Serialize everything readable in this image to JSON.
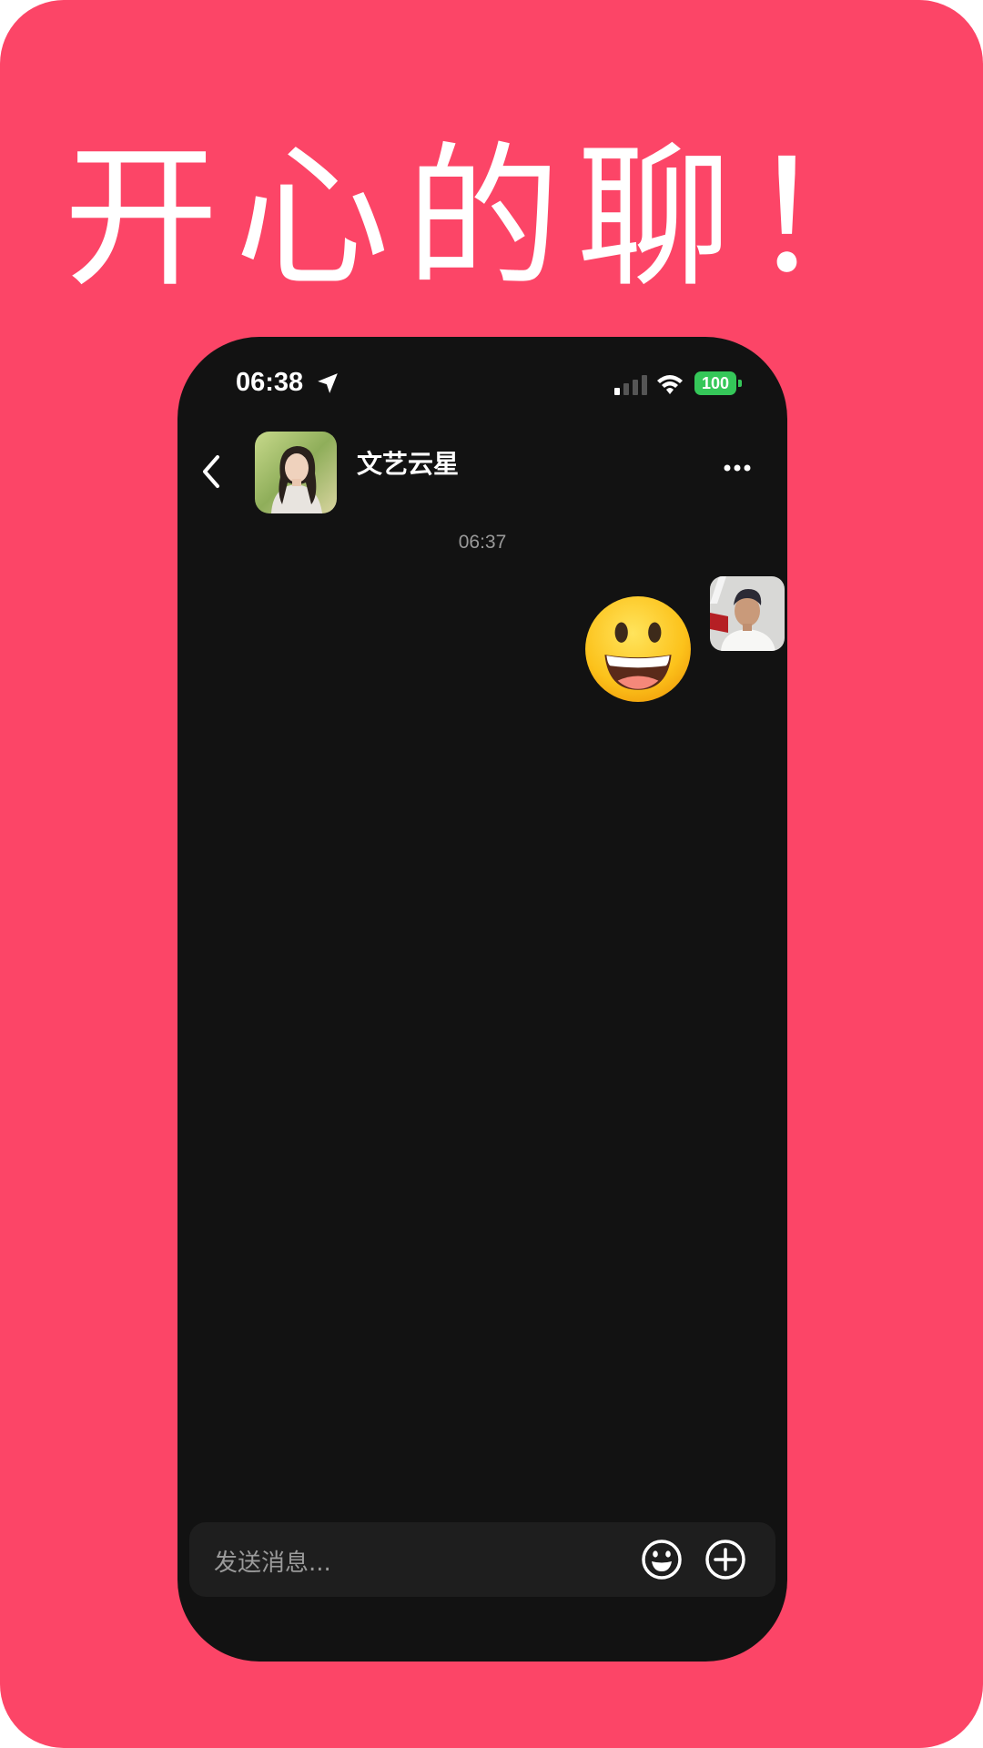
{
  "headline": "开心的聊！",
  "status_bar": {
    "time": "06:38",
    "battery": "100",
    "icons": [
      "location-arrow-icon",
      "cellular-signal-icon",
      "wifi-icon",
      "battery-icon"
    ]
  },
  "chat_header": {
    "contact_name": "文艺云星",
    "icons": [
      "back-arrow-icon",
      "more-dots-icon"
    ]
  },
  "messages": {
    "timestamp": "06:37",
    "items": [
      {
        "sender": "self",
        "type": "emoji",
        "icon": "grinning-face-emoji"
      }
    ]
  },
  "input_bar": {
    "placeholder": "发送消息...",
    "icons": [
      "emoji-smile-icon",
      "plus-circle-icon"
    ]
  },
  "colors": {
    "background": "#fc4567",
    "phone": "#121212",
    "input": "#1e1e1e",
    "battery": "#35c759",
    "muted_text": "#9a9a9a"
  }
}
